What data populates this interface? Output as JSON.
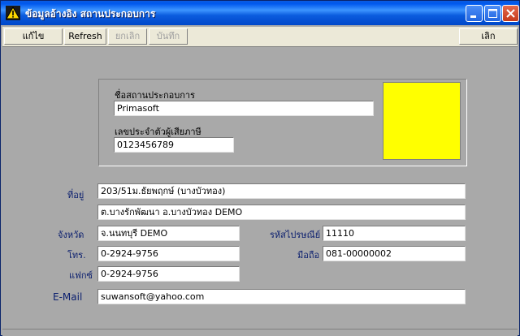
{
  "window": {
    "title": "ข้อมูลอ้างอิง สถานประกอบการ",
    "accent": "#0058ee"
  },
  "toolbar": {
    "edit_label": "แก้ไข",
    "refresh_label": "Refresh",
    "undo_label": "ยกเลิก",
    "save_label": "บันทึก",
    "exit_label": "เลิก"
  },
  "company": {
    "name_label": "ชื่อสถานประกอบการ",
    "name_value": "Primasoft",
    "tax_label": "เลขประจำตัวผู้เสียภาษี",
    "tax_value": "0123456789",
    "logo_color": "#ffff00"
  },
  "address": {
    "label": "ที่อยู่",
    "line1": "203/51ม.ธัยพฤกษ์ (บางบัวทอง)",
    "line2": "ต.บางรักพัฒนา อ.บางบัวทอง DEMO"
  },
  "province": {
    "label": "จังหวัด",
    "value": "จ.นนทบุรี DEMO"
  },
  "postcode": {
    "label": "รหัสไปรษณีย์",
    "value": "11110"
  },
  "phone": {
    "label": "โทร.",
    "value": "0-2924-9756"
  },
  "mobile": {
    "label": "มือถือ",
    "value": "081-00000002"
  },
  "fax": {
    "label": "แฟกซ์",
    "value": "0-2924-9756"
  },
  "email": {
    "label": "E-Mail",
    "value": "suwansoft@yahoo.com"
  }
}
